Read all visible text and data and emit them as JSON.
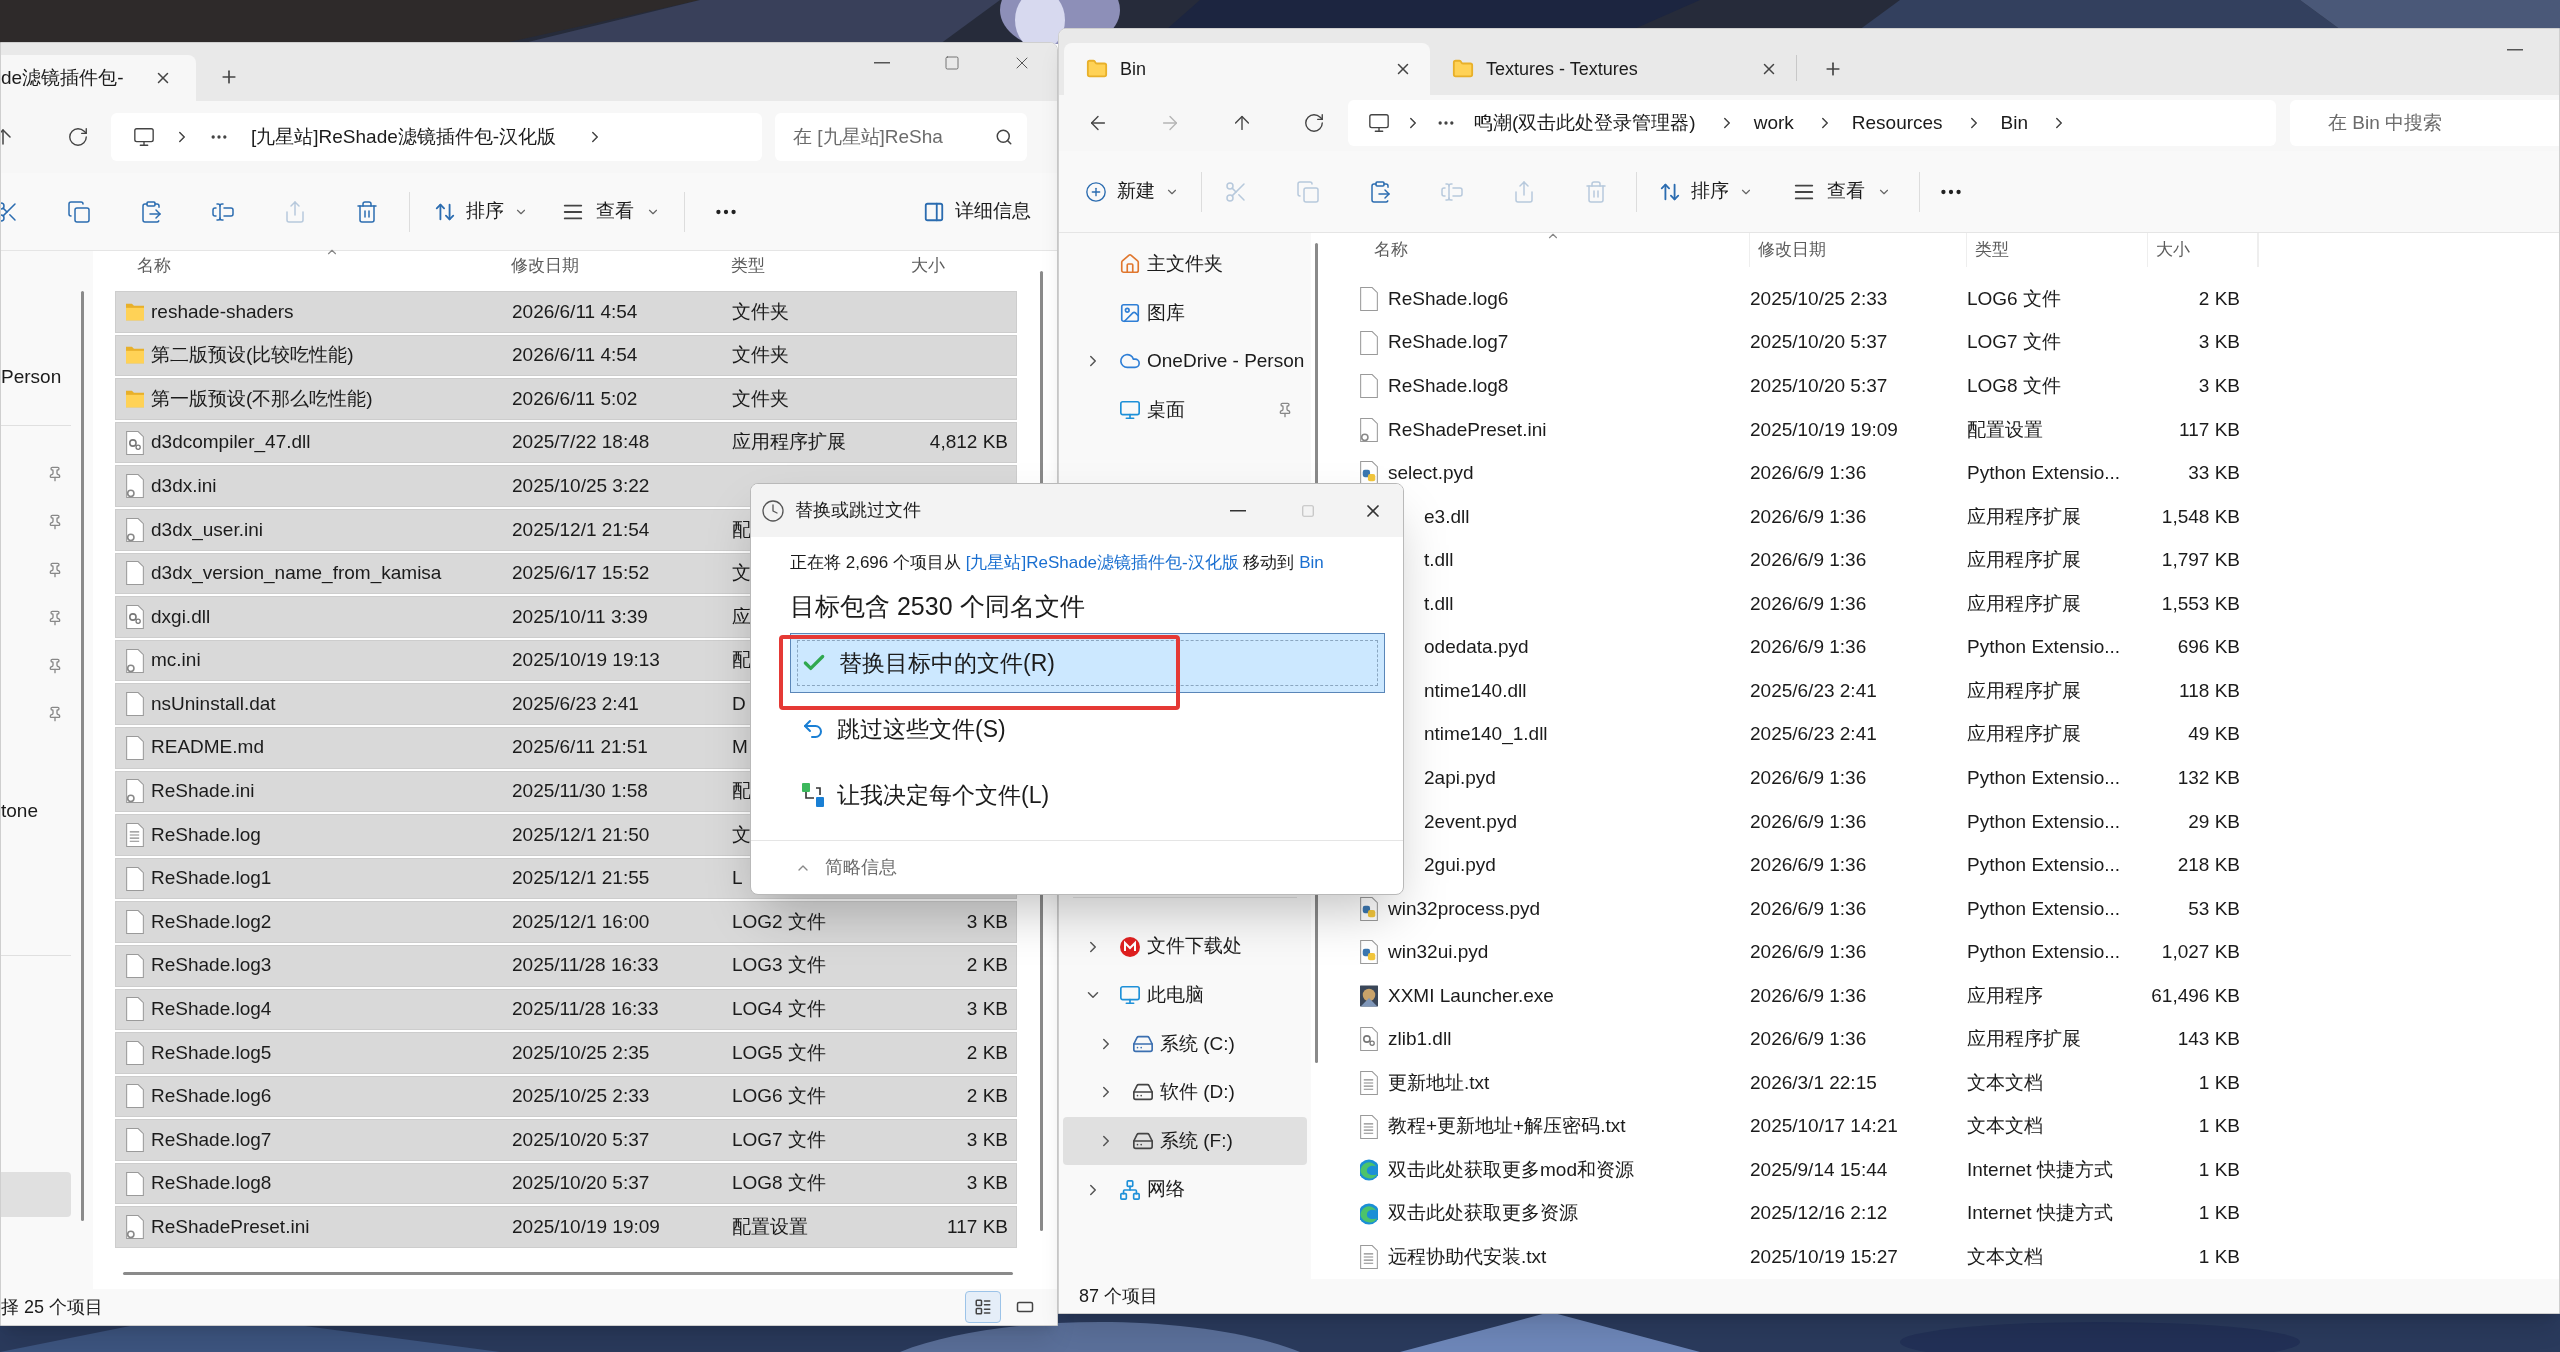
{
  "left_window": {
    "tab": {
      "title": "de滤镜插件包-"
    },
    "breadcrumb": [
      "[九星站]ReShade滤镜插件包-汉化版"
    ],
    "search": {
      "placeholder": "在 [九星站]ReSha"
    },
    "tools": [
      {
        "kind": "cut",
        "disabled": false
      },
      {
        "kind": "copy",
        "disabled": false
      },
      {
        "kind": "paste",
        "disabled": false
      },
      {
        "kind": "rename",
        "disabled": false
      },
      {
        "kind": "share",
        "disabled": true
      },
      {
        "kind": "delete",
        "disabled": false
      }
    ],
    "sort": "排序",
    "view": "查看",
    "details": "详细信息",
    "sidebar": [
      {
        "items": [
          {
            "kind": "label",
            "label": "Person",
            "selected": false
          }
        ]
      },
      {
        "items": [
          {
            "kind": "pin",
            "selected": false
          },
          {
            "kind": "pin",
            "selected": false
          },
          {
            "kind": "pin",
            "selected": false
          },
          {
            "kind": "pin",
            "selected": false
          },
          {
            "kind": "pin",
            "selected": false
          },
          {
            "kind": "pin",
            "selected": false
          },
          {
            "kind": "label",
            "label": "tone",
            "selected": false
          }
        ]
      },
      {
        "items": [
          {
            "kind": "blank",
            "selected": true
          }
        ]
      }
    ],
    "columns": [
      "名称",
      "修改日期",
      "类型",
      "大小"
    ],
    "rows": [
      {
        "kind": "folder",
        "name": "reshade-shaders",
        "date": "2026/6/11 4:54",
        "type": "文件夹",
        "selected": true
      },
      {
        "kind": "folder",
        "name": "第二版预设(比较吃性能)",
        "date": "2026/6/11 4:54",
        "type": "文件夹",
        "selected": true
      },
      {
        "kind": "folder",
        "name": "第一版预设(不那么吃性能)",
        "date": "2026/6/11 5:02",
        "type": "文件夹",
        "selected": true
      },
      {
        "kind": "dll",
        "name": "d3dcompiler_47.dll",
        "date": "2025/7/22 18:48",
        "type": "应用程序扩展",
        "size": "4,812 KB",
        "selected": true
      },
      {
        "kind": "ini",
        "name": "d3dx.ini",
        "date": "2025/10/25 3:22",
        "selected": true
      },
      {
        "kind": "ini",
        "name": "d3dx_user.ini",
        "date": "2025/12/1 21:54",
        "type": "配",
        "selected": true
      },
      {
        "kind": "file",
        "name": "d3dx_version_name_from_kamisa",
        "date": "2025/6/17 15:52",
        "type": "文",
        "selected": true
      },
      {
        "kind": "dll",
        "name": "dxgi.dll",
        "date": "2025/10/11 3:39",
        "type": "应",
        "selected": true
      },
      {
        "kind": "ini",
        "name": "mc.ini",
        "date": "2025/10/19 19:13",
        "type": "配",
        "selected": true
      },
      {
        "kind": "file",
        "name": "nsUninstall.dat",
        "date": "2025/6/23 2:41",
        "type": "D",
        "selected": true
      },
      {
        "kind": "file",
        "name": "README.md",
        "date": "2025/6/11 21:51",
        "type": "M",
        "selected": true
      },
      {
        "kind": "ini",
        "name": "ReShade.ini",
        "date": "2025/11/30 1:58",
        "type": "配",
        "selected": true
      },
      {
        "kind": "text",
        "name": "ReShade.log",
        "date": "2025/12/1 21:50",
        "type": "文",
        "selected": true
      },
      {
        "kind": "file",
        "name": "ReShade.log1",
        "date": "2025/12/1 21:55",
        "type": "L",
        "selected": true
      },
      {
        "kind": "file",
        "name": "ReShade.log2",
        "date": "2025/12/1 16:00",
        "type": "LOG2 文件",
        "size": "3 KB",
        "selected": true
      },
      {
        "kind": "file",
        "name": "ReShade.log3",
        "date": "2025/11/28 16:33",
        "type": "LOG3 文件",
        "size": "2 KB",
        "selected": true
      },
      {
        "kind": "file",
        "name": "ReShade.log4",
        "date": "2025/11/28 16:33",
        "type": "LOG4 文件",
        "size": "3 KB",
        "selected": true
      },
      {
        "kind": "file",
        "name": "ReShade.log5",
        "date": "2025/10/25 2:35",
        "type": "LOG5 文件",
        "size": "2 KB",
        "selected": true
      },
      {
        "kind": "file",
        "name": "ReShade.log6",
        "date": "2025/10/25 2:33",
        "type": "LOG6 文件",
        "size": "2 KB",
        "selected": true
      },
      {
        "kind": "file",
        "name": "ReShade.log7",
        "date": "2025/10/20 5:37",
        "type": "LOG7 文件",
        "size": "3 KB",
        "selected": true
      },
      {
        "kind": "file",
        "name": "ReShade.log8",
        "date": "2025/10/20 5:37",
        "type": "LOG8 文件",
        "size": "3 KB",
        "selected": true
      },
      {
        "kind": "ini",
        "name": "ReShadePreset.ini",
        "date": "2025/10/19 19:09",
        "type": "配置设置",
        "size": "117 KB",
        "selected": true
      }
    ],
    "status": "择 25 个项目",
    "view_modes": [
      {
        "kind": "details",
        "selected": true
      },
      {
        "kind": "tiles",
        "selected": false
      }
    ]
  },
  "right_window": {
    "tabs": [
      {
        "title": "Bin",
        "selected": true
      },
      {
        "title": "Textures - Textures",
        "selected": false
      }
    ],
    "nav_buttons": [
      {
        "kind": "back",
        "disabled": false
      },
      {
        "kind": "forward",
        "disabled": true
      },
      {
        "kind": "up",
        "disabled": false
      },
      {
        "kind": "refresh",
        "disabled": false
      }
    ],
    "breadcrumb": [
      "鸣潮(双击此处登录管理器)",
      "work",
      "Resources",
      "Bin"
    ],
    "search": {
      "placeholder": "在 Bin 中搜索"
    },
    "new": "新建",
    "tools": [
      {
        "kind": "cut",
        "disabled": true
      },
      {
        "kind": "copy",
        "disabled": true
      },
      {
        "kind": "paste",
        "disabled": false
      },
      {
        "kind": "rename",
        "disabled": true
      },
      {
        "kind": "share",
        "disabled": true
      },
      {
        "kind": "delete",
        "disabled": true
      }
    ],
    "sort": "排序",
    "view": "查看",
    "nav_top": [
      {
        "kind": "home",
        "label": "主文件夹"
      },
      {
        "kind": "gallery",
        "label": "图库"
      },
      {
        "kind": "cloud",
        "label": "OneDrive - Person",
        "expanded": false
      },
      {
        "kind": "desktop",
        "label": "桌面",
        "pinned": true
      }
    ],
    "nav_bottom": [
      {
        "kind": "download",
        "label": "文件下载处",
        "expanded": false,
        "selected": false
      },
      {
        "kind": "pc",
        "label": "此电脑",
        "expanded": true,
        "selected": false,
        "children": [
          {
            "kind": "windrive",
            "label": "系统 (C:)",
            "expanded": false,
            "selected": false
          },
          {
            "kind": "drive",
            "label": "软件 (D:)",
            "expanded": false,
            "selected": false
          },
          {
            "kind": "drive",
            "label": "系统 (F:)",
            "expanded": false,
            "selected": true
          }
        ]
      },
      {
        "kind": "network",
        "label": "网络",
        "expanded": false,
        "selected": false
      }
    ],
    "columns": [
      "名称",
      "修改日期",
      "类型",
      "大小"
    ],
    "rows": [
      {
        "kind": "file",
        "name": "ReShade.log6",
        "date": "2025/10/25 2:33",
        "type": "LOG6 文件",
        "size": "2 KB",
        "selected": false
      },
      {
        "kind": "file",
        "name": "ReShade.log7",
        "date": "2025/10/20 5:37",
        "type": "LOG7 文件",
        "size": "3 KB",
        "selected": false
      },
      {
        "kind": "file",
        "name": "ReShade.log8",
        "date": "2025/10/20 5:37",
        "type": "LOG8 文件",
        "size": "3 KB",
        "selected": false
      },
      {
        "kind": "ini",
        "name": "ReShadePreset.ini",
        "date": "2025/10/19 19:09",
        "type": "配置设置",
        "size": "117 KB",
        "selected": false
      },
      {
        "kind": "py",
        "name": "select.pyd",
        "date": "2026/6/9 1:36",
        "type": "Python Extensio...",
        "size": "33 KB",
        "selected": false
      },
      {
        "kind": "covered",
        "name": "e3.dll",
        "date": "2026/6/9 1:36",
        "type": "应用程序扩展",
        "size": "1,548 KB",
        "selected": false
      },
      {
        "kind": "covered",
        "name": "t.dll",
        "date": "2026/6/9 1:36",
        "type": "应用程序扩展",
        "size": "1,797 KB",
        "selected": false
      },
      {
        "kind": "covered",
        "name": "t.dll",
        "date": "2026/6/9 1:36",
        "type": "应用程序扩展",
        "size": "1,553 KB",
        "selected": false
      },
      {
        "kind": "covered",
        "name": "odedata.pyd",
        "date": "2026/6/9 1:36",
        "type": "Python Extensio...",
        "size": "696 KB",
        "selected": false
      },
      {
        "kind": "covered",
        "name": "ntime140.dll",
        "date": "2025/6/23 2:41",
        "type": "应用程序扩展",
        "size": "118 KB",
        "selected": false
      },
      {
        "kind": "covered",
        "name": "ntime140_1.dll",
        "date": "2025/6/23 2:41",
        "type": "应用程序扩展",
        "size": "49 KB",
        "selected": false
      },
      {
        "kind": "covered",
        "name": "2api.pyd",
        "date": "2026/6/9 1:36",
        "type": "Python Extensio...",
        "size": "132 KB",
        "selected": false
      },
      {
        "kind": "covered",
        "name": "2event.pyd",
        "date": "2026/6/9 1:36",
        "type": "Python Extensio...",
        "size": "29 KB",
        "selected": false
      },
      {
        "kind": "covered",
        "name": "2gui.pyd",
        "date": "2026/6/9 1:36",
        "type": "Python Extensio...",
        "size": "218 KB",
        "selected": false
      },
      {
        "kind": "py",
        "name": "win32process.pyd",
        "date": "2026/6/9 1:36",
        "type": "Python Extensio...",
        "size": "53 KB",
        "selected": false
      },
      {
        "kind": "py",
        "name": "win32ui.pyd",
        "date": "2026/6/9 1:36",
        "type": "Python Extensio...",
        "size": "1,027 KB",
        "selected": false
      },
      {
        "kind": "exe",
        "name": "XXMI Launcher.exe",
        "date": "2026/6/9 1:36",
        "type": "应用程序",
        "size": "61,496 KB",
        "selected": false
      },
      {
        "kind": "dll",
        "name": "zlib1.dll",
        "date": "2026/6/9 1:36",
        "type": "应用程序扩展",
        "size": "143 KB",
        "selected": false
      },
      {
        "kind": "text",
        "name": "更新地址.txt",
        "date": "2026/3/1 22:15",
        "type": "文本文档",
        "size": "1 KB",
        "selected": false
      },
      {
        "kind": "text",
        "name": "教程+更新地址+解压密码.txt",
        "date": "2025/10/17 14:21",
        "type": "文本文档",
        "size": "1 KB",
        "selected": false
      },
      {
        "kind": "link",
        "name": "双击此处获取更多mod和资源",
        "date": "2025/9/14 15:44",
        "type": "Internet 快捷方式",
        "size": "1 KB",
        "selected": false
      },
      {
        "kind": "link",
        "name": "双击此处获取更多资源",
        "date": "2025/12/16 2:12",
        "type": "Internet 快捷方式",
        "size": "1 KB",
        "selected": false
      },
      {
        "kind": "text",
        "name": "远程协助代安装.txt",
        "date": "2025/10/19 15:27",
        "type": "文本文档",
        "size": "1 KB",
        "selected": false
      }
    ],
    "status": "87 个项目"
  },
  "dialog": {
    "title": "替换或跳过文件",
    "message": [
      {
        "text": "正在将 2,696 个项目从 ",
        "link": false
      },
      {
        "text": "[九星站]ReShade滤镜插件包-汉化版",
        "link": true
      },
      {
        "text": " 移动到 ",
        "link": false
      },
      {
        "text": "Bin",
        "link": true
      }
    ],
    "heading": "目标包含 2530 个同名文件",
    "options": [
      {
        "kind": "replace",
        "label": "替换目标中的文件(R)",
        "selected": true
      },
      {
        "kind": "skip",
        "label": "跳过这些文件(S)",
        "selected": false
      },
      {
        "kind": "decide",
        "label": "让我决定每个文件(L)",
        "selected": false
      }
    ],
    "details_toggle": "简略信息"
  }
}
